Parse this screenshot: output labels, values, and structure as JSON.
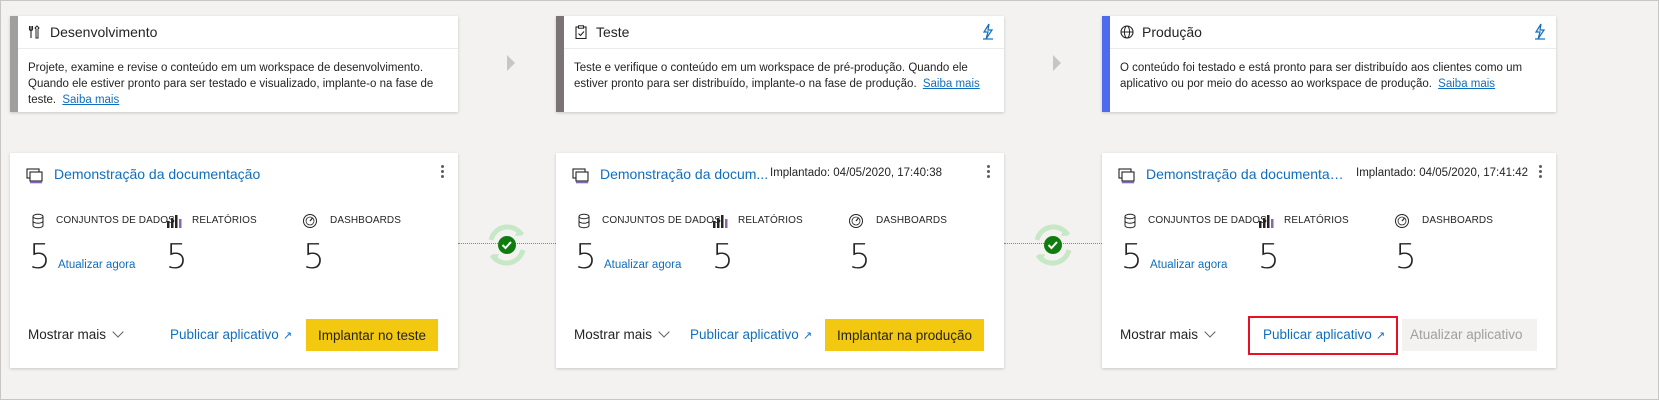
{
  "stages": [
    {
      "title": "Desenvolvimento",
      "description": "Projete, examine e revise o conteúdo em um workspace de desenvolvimento. Quando ele estiver pronto para ser testado e visualizado, implante-o na fase de teste.",
      "link": "Saiba mais",
      "color": "#a19f9d"
    },
    {
      "title": "Teste",
      "description": "Teste e verifique o conteúdo em um workspace de pré-produção. Quando ele estiver pronto para ser distribuído, implante-o na fase de produção.",
      "link": "Saiba mais",
      "color": "#7a7574"
    },
    {
      "title": "Produção",
      "description": "O conteúdo foi testado e está pronto para ser distribuído aos clientes como um aplicativo ou por meio do acesso ao workspace de produção.",
      "link": "Saiba mais",
      "color": "#4f6bed"
    }
  ],
  "workspaces": [
    {
      "name": "Demonstração da documentação",
      "deployed": "",
      "datasets_label": "CONJUNTOS DE DADOS",
      "datasets_count": "5",
      "refresh_label": "Atualizar agora",
      "reports_label": "RELATÓRIOS",
      "reports_count": "5",
      "dashboards_label": "DASHBOARDS",
      "dashboards_count": "5",
      "show_more": "Mostrar mais",
      "publish": "Publicar aplicativo",
      "action": "Implantar no teste"
    },
    {
      "name": "Demonstração da docum...",
      "deployed": "Implantado: 04/05/2020, 17:40:38",
      "datasets_label": "CONJUNTOS DE DADOS",
      "datasets_count": "5",
      "refresh_label": "Atualizar agora",
      "reports_label": "RELATÓRIOS",
      "reports_count": "5",
      "dashboards_label": "DASHBOARDS",
      "dashboards_count": "5",
      "show_more": "Mostrar mais",
      "publish": "Publicar aplicativo",
      "action": "Implantar na produção"
    },
    {
      "name": "Demonstração da documentaç...",
      "deployed": "Implantado: 04/05/2020, 17:41:42",
      "datasets_label": "CONJUNTOS DE DADOS",
      "datasets_count": "5",
      "refresh_label": "Atualizar agora",
      "reports_label": "RELATÓRIOS",
      "reports_count": "5",
      "dashboards_label": "DASHBOARDS",
      "dashboards_count": "5",
      "show_more": "Mostrar mais",
      "publish": "Publicar aplicativo",
      "action": "Atualizar aplicativo"
    }
  ],
  "colors": {
    "accent_link": "#106ebe",
    "deploy_button": "#f2c811",
    "sync_ok": "#107c10",
    "highlight": "#e81123"
  }
}
